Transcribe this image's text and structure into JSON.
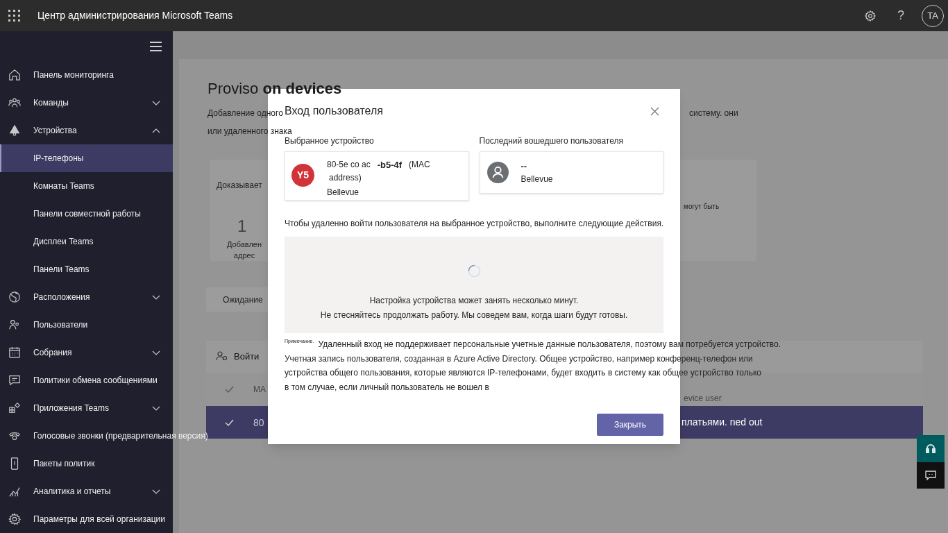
{
  "header": {
    "title": "Центр администрирования Microsoft Teams",
    "user_initials": "TA",
    "help": "?"
  },
  "sidebar": {
    "items": [
      {
        "label": "Панель мониторинга",
        "selected": false
      },
      {
        "label": "Команды",
        "selected": false,
        "expanded": false
      },
      {
        "label": "Устройства",
        "selected": false,
        "expanded": true,
        "children": [
          {
            "label": "IP-телефоны",
            "selected": true
          },
          {
            "label": "Комнаты Teams",
            "selected": false
          },
          {
            "label": "Панели совместной работы",
            "selected": false
          },
          {
            "label": "Дисплеи Teams",
            "selected": false
          },
          {
            "label": "Панели Teams",
            "selected": false
          }
        ]
      },
      {
        "label": "Расположения",
        "selected": false,
        "expanded": false
      },
      {
        "label": "Пользователи",
        "selected": false
      },
      {
        "label": "Собрания",
        "selected": false,
        "expanded": false
      },
      {
        "label": "Политики обмена сообщениями",
        "selected": false
      },
      {
        "label": "Приложения Teams",
        "selected": false,
        "expanded": false
      },
      {
        "label": "Голосовые звонки (предварительная версия)",
        "selected": false
      },
      {
        "label": "Пакеты политик",
        "selected": false
      },
      {
        "label": "Аналитика и отчеты",
        "selected": false,
        "expanded": false
      },
      {
        "label": "Параметры для всей организации",
        "selected": false
      }
    ]
  },
  "page": {
    "title": "Proviso **on devices**",
    "description": [
      "Добавление одного",
      "или удаленного знака"
    ],
    "description_right": "систему. они",
    "card": {
      "label": "Доказывает",
      "count": "1",
      "caption": [
        "Добавлен",
        "адрес"
      ],
      "right_text": "могут быть"
    },
    "tab": "Ожидание",
    "action": "Войти",
    "table": {
      "columns": [
        "MA",
        "evice user"
      ],
      "rows": [
        {
          "selected": true,
          "cells": [
            "80",
            "платьями. ned out"
          ]
        }
      ]
    }
  },
  "dialog": {
    "title": "Вход пользователя",
    "device": {
      "label": "Выбранное устройство",
      "initials": "Y5",
      "name": "80-5e co ac",
      "name_bold": "-b5-4f",
      "name_suffix": "(MAC",
      "name_line2": "address)",
      "location": "Bellevue"
    },
    "last_user": {
      "label": "Последний вошедшего пользователя",
      "name": "--",
      "location": "Bellevue"
    },
    "instruction": "Чтобы удаленно войти пользователя на выбранное устройство, выполните следующие действия.",
    "progress": [
      "Настройка устройства может занять несколько минут.",
      "Не стесняйтесь продолжать работу. Мы соведем вам, когда шаги будут готовы."
    ],
    "note": {
      "label": "Примечание.",
      "lines": [
        "Удаленный вход не поддерживает персональные учетные данные пользователя, поэтому вам потребуется устройство.",
        "Учетная запись пользователя, созданная в Azure Active Directory. Общее устройство, например конференц-телефон или",
        "устройства общего пользования, которые являются IP-телефонами, будет входить в систему как общее устройство только",
        "в том случае, если личный пользователь не вошел в"
      ]
    },
    "button": "Закрыть"
  }
}
